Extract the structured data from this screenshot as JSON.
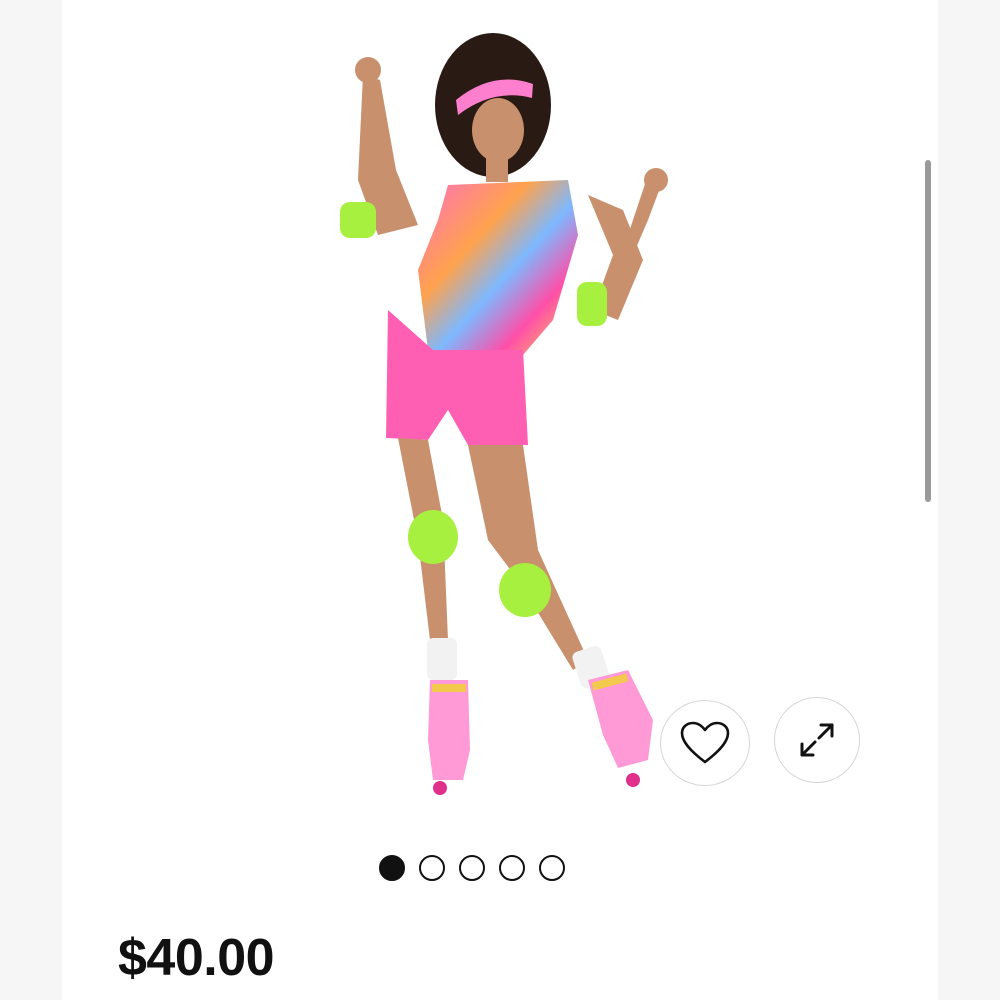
{
  "product": {
    "price": "$40.00",
    "gallery": {
      "total": 5,
      "active": 1
    }
  },
  "icons": {
    "favorite": "heart-icon",
    "expand": "expand-arrows-icon"
  },
  "colors": {
    "pink": "#ff5fb3",
    "neon_green": "#a7f040",
    "dot_active": "#111111"
  }
}
